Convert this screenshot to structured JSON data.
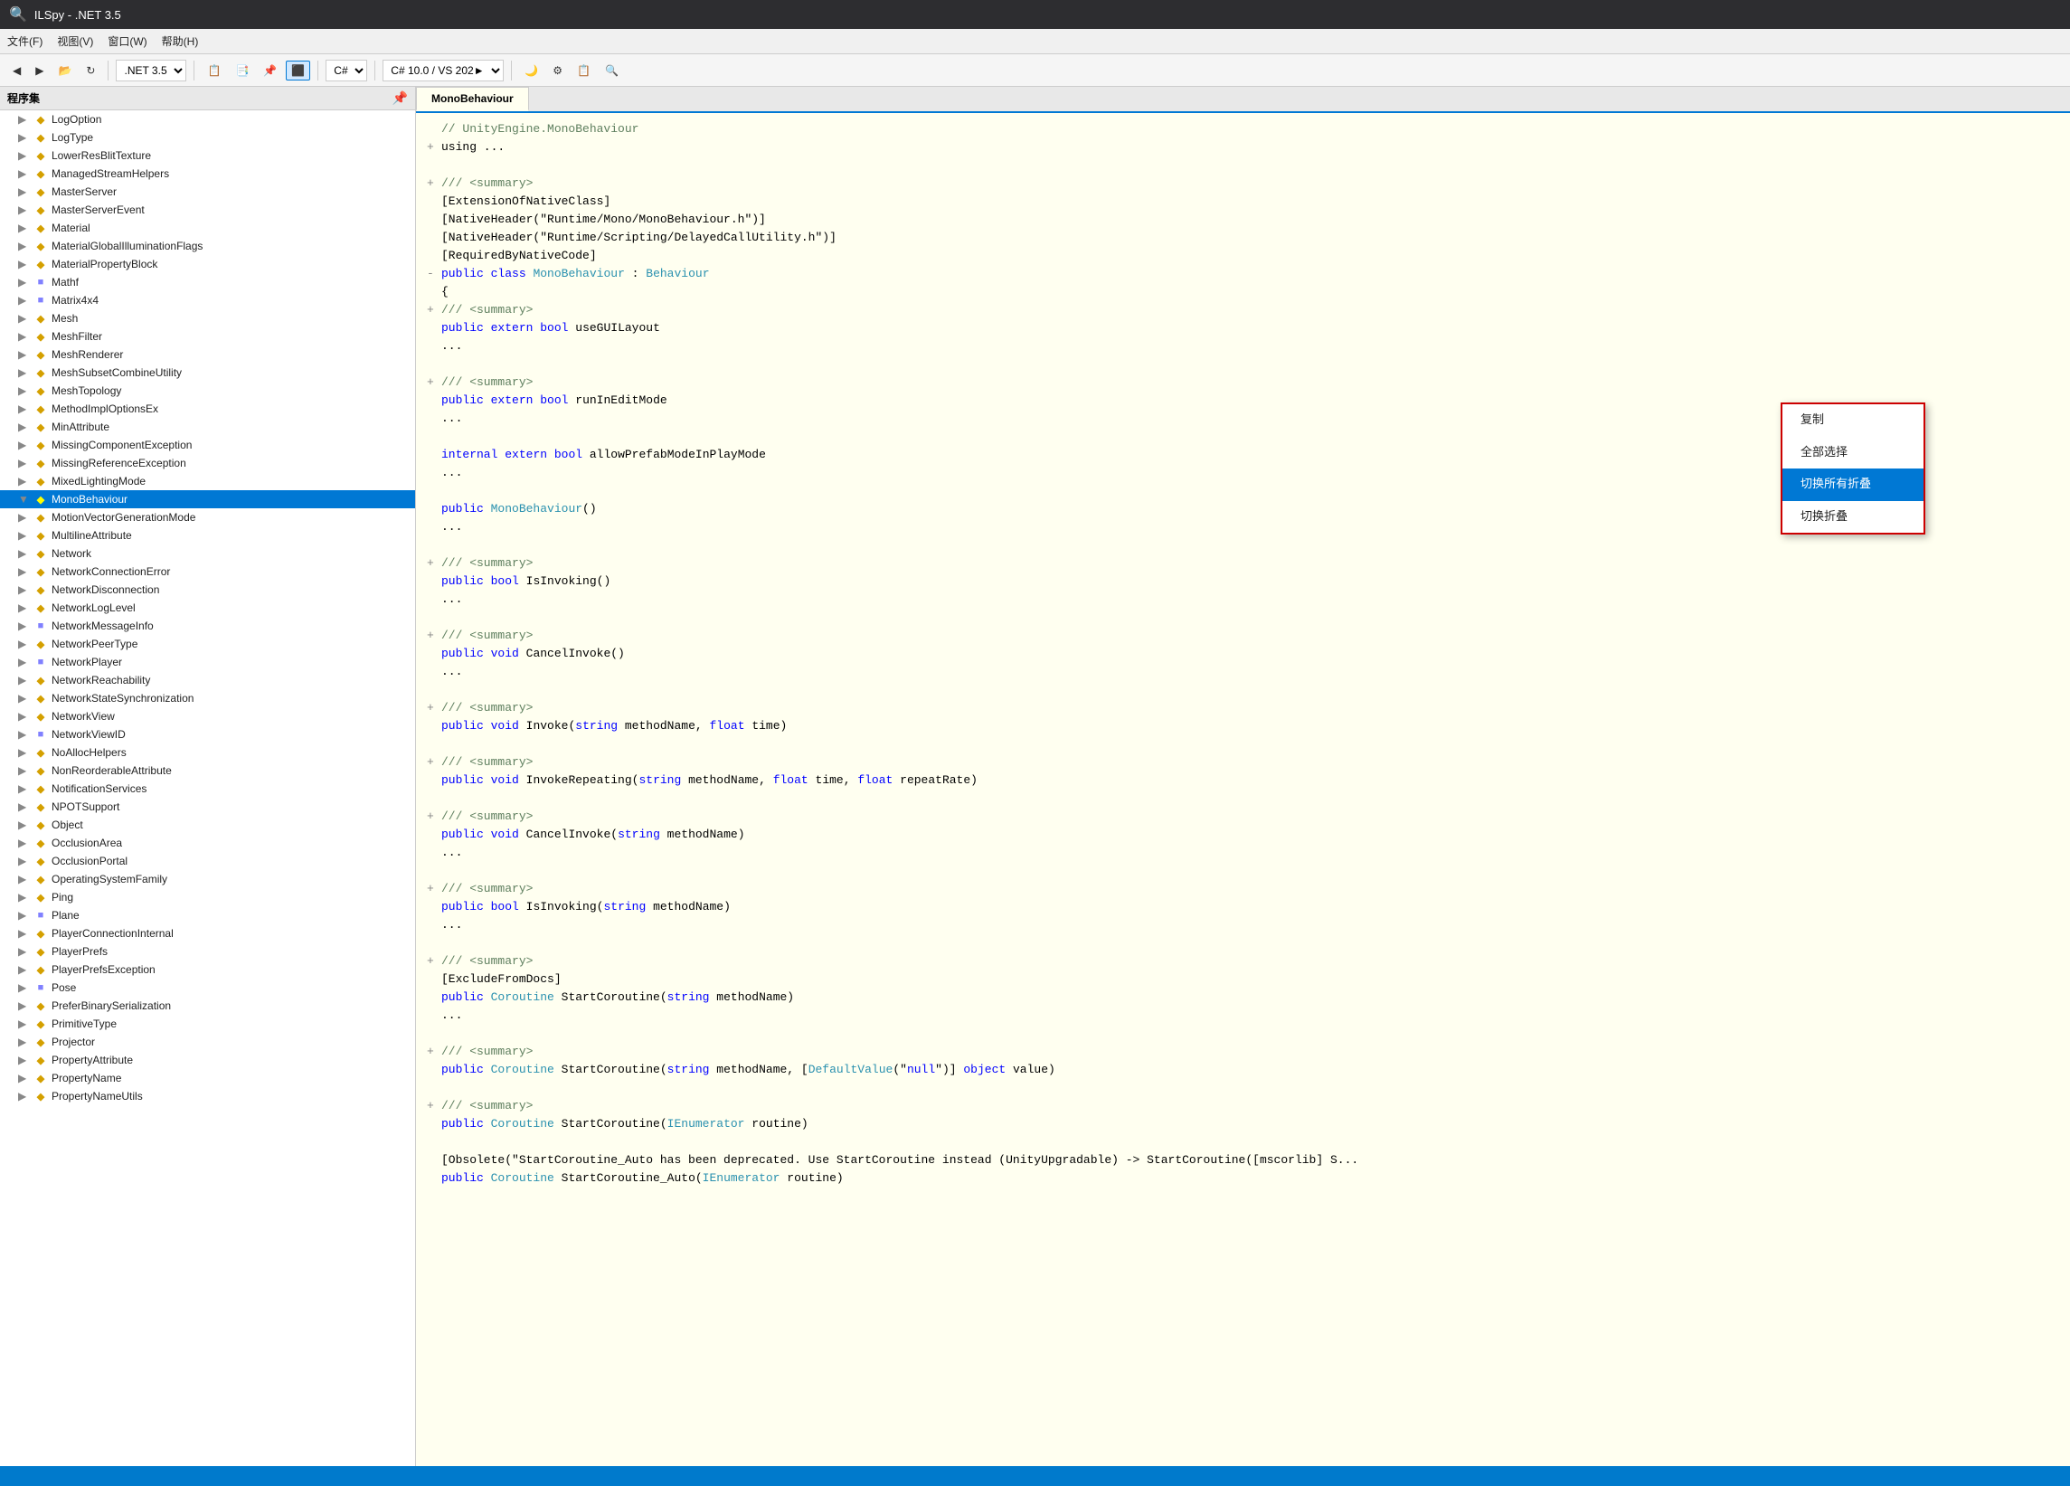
{
  "titleBar": {
    "icon": "🔍",
    "title": "ILSpy - .NET 3.5"
  },
  "menuBar": {
    "items": [
      "文件(F)",
      "视图(V)",
      "窗口(W)",
      "帮助(H)"
    ]
  },
  "toolbar": {
    "dotnetVersion": ".NET 3.5",
    "languageC": "C#",
    "languageVersion": "C# 10.0 / VS 202►"
  },
  "leftPanel": {
    "title": "程序集"
  },
  "activeTab": "MonoBehaviour",
  "treeItems": [
    {
      "id": "LogOption",
      "label": "LogOption",
      "type": "class",
      "indent": 1,
      "expanded": false
    },
    {
      "id": "LogType",
      "label": "LogType",
      "type": "class",
      "indent": 1,
      "expanded": false
    },
    {
      "id": "LowerResBlitTexture",
      "label": "LowerResBlitTexture",
      "type": "class",
      "indent": 1,
      "expanded": false
    },
    {
      "id": "ManagedStreamHelpers",
      "label": "ManagedStreamHelpers",
      "type": "class",
      "indent": 1,
      "expanded": false
    },
    {
      "id": "MasterServer",
      "label": "MasterServer",
      "type": "class",
      "indent": 1,
      "expanded": false
    },
    {
      "id": "MasterServerEvent",
      "label": "MasterServerEvent",
      "type": "class",
      "indent": 1,
      "expanded": false
    },
    {
      "id": "Material",
      "label": "Material",
      "type": "class",
      "indent": 1,
      "expanded": false
    },
    {
      "id": "MaterialGlobalIlluminationFlags",
      "label": "MaterialGlobalIlluminationFlags",
      "type": "class",
      "indent": 1,
      "expanded": false
    },
    {
      "id": "MaterialPropertyBlock",
      "label": "MaterialPropertyBlock",
      "type": "class",
      "indent": 1,
      "expanded": false
    },
    {
      "id": "Mathf",
      "label": "Mathf",
      "type": "struct",
      "indent": 1,
      "expanded": false
    },
    {
      "id": "Matrix4x4",
      "label": "Matrix4x4",
      "type": "struct",
      "indent": 1,
      "expanded": false
    },
    {
      "id": "Mesh",
      "label": "Mesh",
      "type": "class",
      "indent": 1,
      "expanded": false
    },
    {
      "id": "MeshFilter",
      "label": "MeshFilter",
      "type": "class",
      "indent": 1,
      "expanded": false
    },
    {
      "id": "MeshRenderer",
      "label": "MeshRenderer",
      "type": "class",
      "indent": 1,
      "expanded": false
    },
    {
      "id": "MeshSubsetCombineUtility",
      "label": "MeshSubsetCombineUtility",
      "type": "class",
      "indent": 1,
      "expanded": false
    },
    {
      "id": "MeshTopology",
      "label": "MeshTopology",
      "type": "class",
      "indent": 1,
      "expanded": false
    },
    {
      "id": "MethodImplOptionsEx",
      "label": "MethodImplOptionsEx",
      "type": "class",
      "indent": 1,
      "expanded": false
    },
    {
      "id": "MinAttribute",
      "label": "MinAttribute",
      "type": "class",
      "indent": 1,
      "expanded": false
    },
    {
      "id": "MissingComponentException",
      "label": "MissingComponentException",
      "type": "class",
      "indent": 1,
      "expanded": false
    },
    {
      "id": "MissingReferenceException",
      "label": "MissingReferenceException",
      "type": "class",
      "indent": 1,
      "expanded": false
    },
    {
      "id": "MixedLightingMode",
      "label": "MixedLightingMode",
      "type": "class",
      "indent": 1,
      "expanded": false
    },
    {
      "id": "MonoBehaviour",
      "label": "MonoBehaviour",
      "type": "class",
      "indent": 1,
      "expanded": true,
      "selected": true
    },
    {
      "id": "MotionVectorGenerationMode",
      "label": "MotionVectorGenerationMode",
      "type": "class",
      "indent": 1,
      "expanded": false
    },
    {
      "id": "MultilineAttribute",
      "label": "MultilineAttribute",
      "type": "class",
      "indent": 1,
      "expanded": false
    },
    {
      "id": "Network",
      "label": "Network",
      "type": "class",
      "indent": 1,
      "expanded": false
    },
    {
      "id": "NetworkConnectionError",
      "label": "NetworkConnectionError",
      "type": "class",
      "indent": 1,
      "expanded": false
    },
    {
      "id": "NetworkDisconnection",
      "label": "NetworkDisconnection",
      "type": "class",
      "indent": 1,
      "expanded": false
    },
    {
      "id": "NetworkLogLevel",
      "label": "NetworkLogLevel",
      "type": "class",
      "indent": 1,
      "expanded": false
    },
    {
      "id": "NetworkMessageInfo",
      "label": "NetworkMessageInfo",
      "type": "struct",
      "indent": 1,
      "expanded": false
    },
    {
      "id": "NetworkPeerType",
      "label": "NetworkPeerType",
      "type": "class",
      "indent": 1,
      "expanded": false
    },
    {
      "id": "NetworkPlayer",
      "label": "NetworkPlayer",
      "type": "struct",
      "indent": 1,
      "expanded": false
    },
    {
      "id": "NetworkReachability",
      "label": "NetworkReachability",
      "type": "class",
      "indent": 1,
      "expanded": false
    },
    {
      "id": "NetworkStateSynchronization",
      "label": "NetworkStateSynchronization",
      "type": "class",
      "indent": 1,
      "expanded": false
    },
    {
      "id": "NetworkView",
      "label": "NetworkView",
      "type": "class",
      "indent": 1,
      "expanded": false
    },
    {
      "id": "NetworkViewID",
      "label": "NetworkViewID",
      "type": "struct",
      "indent": 1,
      "expanded": false
    },
    {
      "id": "NoAllocHelpers",
      "label": "NoAllocHelpers",
      "type": "class",
      "indent": 1,
      "expanded": false
    },
    {
      "id": "NonReorderableAttribute",
      "label": "NonReorderableAttribute",
      "type": "class",
      "indent": 1,
      "expanded": false
    },
    {
      "id": "NotificationServices",
      "label": "NotificationServices",
      "type": "class",
      "indent": 1,
      "expanded": false
    },
    {
      "id": "NPOTSupport",
      "label": "NPOTSupport",
      "type": "class",
      "indent": 1,
      "expanded": false
    },
    {
      "id": "Object",
      "label": "Object",
      "type": "class",
      "indent": 1,
      "expanded": false
    },
    {
      "id": "OcclusionArea",
      "label": "OcclusionArea",
      "type": "class",
      "indent": 1,
      "expanded": false
    },
    {
      "id": "OcclusionPortal",
      "label": "OcclusionPortal",
      "type": "class",
      "indent": 1,
      "expanded": false
    },
    {
      "id": "OperatingSystemFamily",
      "label": "OperatingSystemFamily",
      "type": "class",
      "indent": 1,
      "expanded": false
    },
    {
      "id": "Ping",
      "label": "Ping",
      "type": "class",
      "indent": 1,
      "expanded": false
    },
    {
      "id": "Plane",
      "label": "Plane",
      "type": "struct",
      "indent": 1,
      "expanded": false
    },
    {
      "id": "PlayerConnectionInternal",
      "label": "PlayerConnectionInternal",
      "type": "class",
      "indent": 1,
      "expanded": false
    },
    {
      "id": "PlayerPrefs",
      "label": "PlayerPrefs",
      "type": "class",
      "indent": 1,
      "expanded": false
    },
    {
      "id": "PlayerPrefsException",
      "label": "PlayerPrefsException",
      "type": "class",
      "indent": 1,
      "expanded": false
    },
    {
      "id": "Pose",
      "label": "Pose",
      "type": "struct",
      "indent": 1,
      "expanded": false
    },
    {
      "id": "PreferBinarySerialization",
      "label": "PreferBinarySerialization",
      "type": "class",
      "indent": 1,
      "expanded": false
    },
    {
      "id": "PrimitiveType",
      "label": "PrimitiveType",
      "type": "class",
      "indent": 1,
      "expanded": false
    },
    {
      "id": "Projector",
      "label": "Projector",
      "type": "class",
      "indent": 1,
      "expanded": false
    },
    {
      "id": "PropertyAttribute",
      "label": "PropertyAttribute",
      "type": "class",
      "indent": 1,
      "expanded": false
    },
    {
      "id": "PropertyName",
      "label": "PropertyName",
      "type": "class",
      "indent": 1,
      "expanded": false
    },
    {
      "id": "PropertyNameUtils",
      "label": "PropertyNameUtils",
      "type": "class",
      "indent": 1,
      "expanded": false
    }
  ],
  "codeLines": [
    {
      "expand": "",
      "text": "// UnityEngine.MonoBehaviour",
      "type": "comment"
    },
    {
      "expand": "+",
      "text": "using ...",
      "type": "normal"
    },
    {
      "expand": "",
      "text": "",
      "type": "normal"
    },
    {
      "expand": "+",
      "text": "/// <summary>",
      "type": "comment"
    },
    {
      "expand": "",
      "text": "[ExtensionOfNativeClass]",
      "type": "attrib"
    },
    {
      "expand": "",
      "text": "[NativeHeader(\"Runtime/Mono/MonoBehaviour.h\")]",
      "type": "attrib"
    },
    {
      "expand": "",
      "text": "[NativeHeader(\"Runtime/Scripting/DelayedCallUtility.h\")]",
      "type": "attrib"
    },
    {
      "expand": "",
      "text": "[RequiredByNativeCode]",
      "type": "attrib"
    },
    {
      "expand": "-",
      "text": "public class MonoBehaviour : Behaviour",
      "type": "declaration"
    },
    {
      "expand": "",
      "text": "{",
      "type": "normal"
    },
    {
      "expand": "+",
      "text": "/// <summary>",
      "type": "comment"
    },
    {
      "expand": "",
      "text": "    public extern bool useGUILayout",
      "type": "member"
    },
    {
      "expand": "",
      "text": "    ...",
      "type": "normal"
    },
    {
      "expand": "",
      "text": "",
      "type": "normal"
    },
    {
      "expand": "+",
      "text": "/// <summary>",
      "type": "comment"
    },
    {
      "expand": "",
      "text": "    public extern bool runInEditMode",
      "type": "member"
    },
    {
      "expand": "",
      "text": "    ...",
      "type": "normal"
    },
    {
      "expand": "",
      "text": "",
      "type": "normal"
    },
    {
      "expand": "",
      "text": "    internal extern bool allowPrefabModeInPlayMode",
      "type": "member"
    },
    {
      "expand": "",
      "text": "    ...",
      "type": "normal"
    },
    {
      "expand": "",
      "text": "",
      "type": "normal"
    },
    {
      "expand": "",
      "text": "    public MonoBehaviour()",
      "type": "member"
    },
    {
      "expand": "",
      "text": "    ...",
      "type": "normal"
    },
    {
      "expand": "",
      "text": "",
      "type": "normal"
    },
    {
      "expand": "+",
      "text": "/// <summary>",
      "type": "comment"
    },
    {
      "expand": "",
      "text": "    public bool IsInvoking()",
      "type": "member"
    },
    {
      "expand": "",
      "text": "    ...",
      "type": "normal"
    },
    {
      "expand": "",
      "text": "",
      "type": "normal"
    },
    {
      "expand": "+",
      "text": "/// <summary>",
      "type": "comment"
    },
    {
      "expand": "",
      "text": "    public void CancelInvoke()",
      "type": "member"
    },
    {
      "expand": "",
      "text": "    ...",
      "type": "normal"
    },
    {
      "expand": "",
      "text": "",
      "type": "normal"
    },
    {
      "expand": "+",
      "text": "/// <summary>",
      "type": "comment"
    },
    {
      "expand": "",
      "text": "    public void Invoke(string methodName, float time)",
      "type": "member"
    },
    {
      "expand": "",
      "text": "",
      "type": "normal"
    },
    {
      "expand": "+",
      "text": "/// <summary>",
      "type": "comment"
    },
    {
      "expand": "",
      "text": "    public void InvokeRepeating(string methodName, float time, float repeatRate)",
      "type": "member"
    },
    {
      "expand": "",
      "text": "",
      "type": "normal"
    },
    {
      "expand": "+",
      "text": "/// <summary>",
      "type": "comment"
    },
    {
      "expand": "",
      "text": "    public void CancelInvoke(string methodName)",
      "type": "member"
    },
    {
      "expand": "",
      "text": "    ...",
      "type": "normal"
    },
    {
      "expand": "",
      "text": "",
      "type": "normal"
    },
    {
      "expand": "+",
      "text": "/// <summary>",
      "type": "comment"
    },
    {
      "expand": "",
      "text": "    public bool IsInvoking(string methodName)",
      "type": "member"
    },
    {
      "expand": "",
      "text": "    ...",
      "type": "normal"
    },
    {
      "expand": "",
      "text": "",
      "type": "normal"
    },
    {
      "expand": "+",
      "text": "/// <summary>",
      "type": "comment"
    },
    {
      "expand": "",
      "text": "    [ExcludeFromDocs]",
      "type": "attrib"
    },
    {
      "expand": "",
      "text": "    public Coroutine StartCoroutine(string methodName)",
      "type": "member"
    },
    {
      "expand": "",
      "text": "    ...",
      "type": "normal"
    },
    {
      "expand": "",
      "text": "",
      "type": "normal"
    },
    {
      "expand": "+",
      "text": "/// <summary>",
      "type": "comment"
    },
    {
      "expand": "",
      "text": "    public Coroutine StartCoroutine(string methodName, [DefaultValue(\"null\")] object value)",
      "type": "member"
    },
    {
      "expand": "",
      "text": "",
      "type": "normal"
    },
    {
      "expand": "+",
      "text": "/// <summary>",
      "type": "comment"
    },
    {
      "expand": "",
      "text": "    public Coroutine StartCoroutine(IEnumerator routine)",
      "type": "member"
    },
    {
      "expand": "",
      "text": "",
      "type": "normal"
    },
    {
      "expand": "",
      "text": "    [Obsolete(\"StartCoroutine_Auto has been deprecated. Use StartCoroutine instead (UnityUpgradable) -> StartCoroutine([mscorlib] S...",
      "type": "attrib"
    },
    {
      "expand": "",
      "text": "    public Coroutine StartCoroutine_Auto(IEnumerator routine)",
      "type": "member"
    }
  ],
  "contextMenu": {
    "items": [
      {
        "label": "复制",
        "id": "copy",
        "highlighted": false
      },
      {
        "label": "全部选择",
        "id": "selectAll",
        "highlighted": false
      },
      {
        "label": "切换所有折叠",
        "id": "toggleAllFolds",
        "highlighted": true
      },
      {
        "label": "切换折叠",
        "id": "toggleFold",
        "highlighted": false
      }
    ]
  },
  "statusBar": {
    "text": ""
  }
}
